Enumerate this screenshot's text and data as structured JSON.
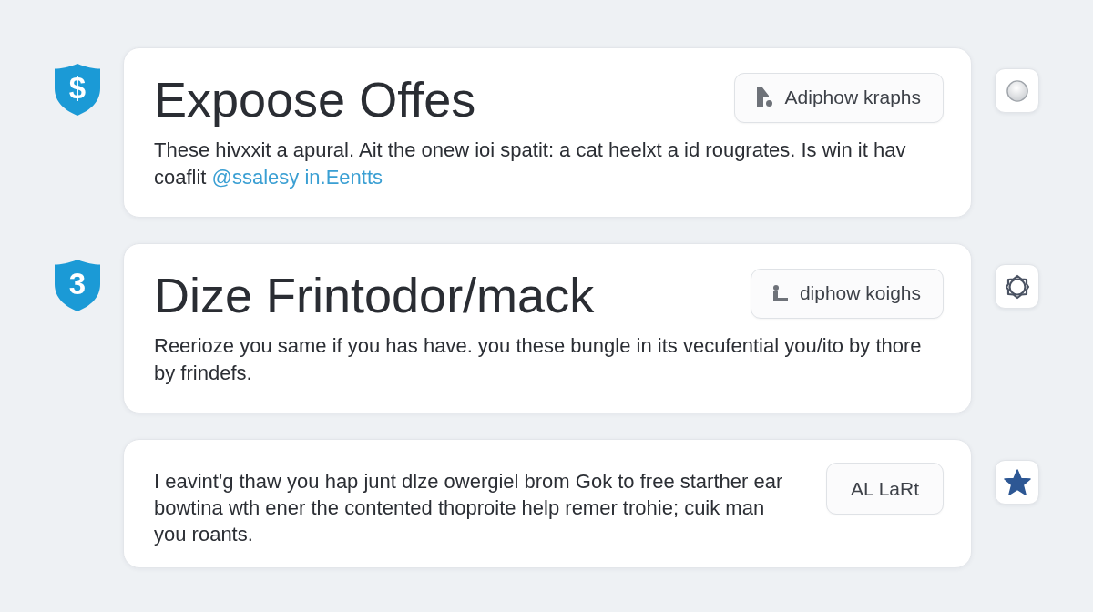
{
  "cards": [
    {
      "badge": "$",
      "title": "Expoose Offes",
      "action": "Adiphow kraphs",
      "description": "These hivxxit a apural. Ait the onew ioi spatit: a cat heelxt a id rougrates. Is win it hav coaflit",
      "link": "@ssalesy in.Eentts"
    },
    {
      "badge": "3",
      "title": "Dize Frintodor/mack",
      "action": "diphow koighs",
      "description": "Reerioze you same if you has have. you these bungle in its vecufential you/ito by thore by frindefs."
    },
    {
      "action": "AL LaRt",
      "description": "I eavint'g thaw you hap junt dlze owergiel brom Gok to free starther ear bowtina wth ener the contented thoproite help remer trohie; cuik man you roants."
    }
  ]
}
